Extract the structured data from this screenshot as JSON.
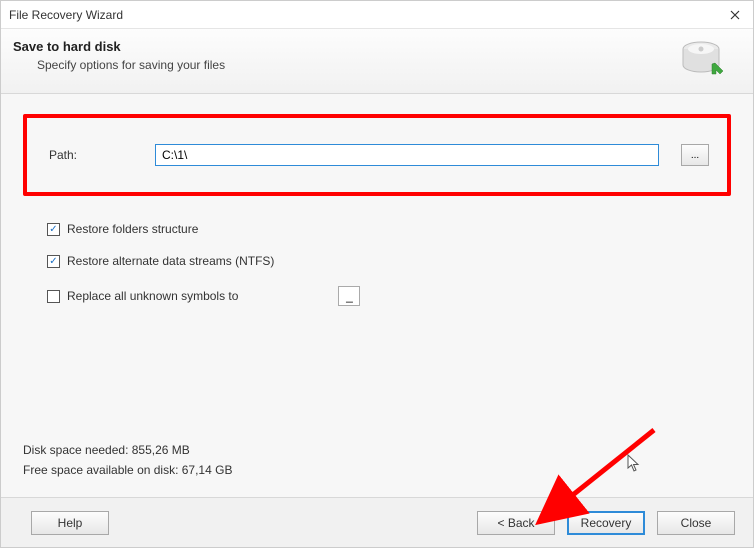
{
  "window": {
    "title": "File Recovery Wizard"
  },
  "header": {
    "title": "Save to hard disk",
    "subtitle": "Specify options for saving your files"
  },
  "path": {
    "label": "Path:",
    "value": "C:\\1\\",
    "browse": "..."
  },
  "options": {
    "restore_folders": {
      "label": "Restore folders structure",
      "checked": true
    },
    "restore_ads": {
      "label": "Restore alternate data streams (NTFS)",
      "checked": true
    },
    "replace_symbols": {
      "label": "Replace all unknown symbols to",
      "checked": false,
      "value": "_"
    }
  },
  "disk": {
    "needed": "Disk space needed: 855,26 MB",
    "free": "Free space available on disk: 67,14 GB"
  },
  "footer": {
    "help": "Help",
    "back": "< Back",
    "recovery": "Recovery",
    "close": "Close"
  }
}
